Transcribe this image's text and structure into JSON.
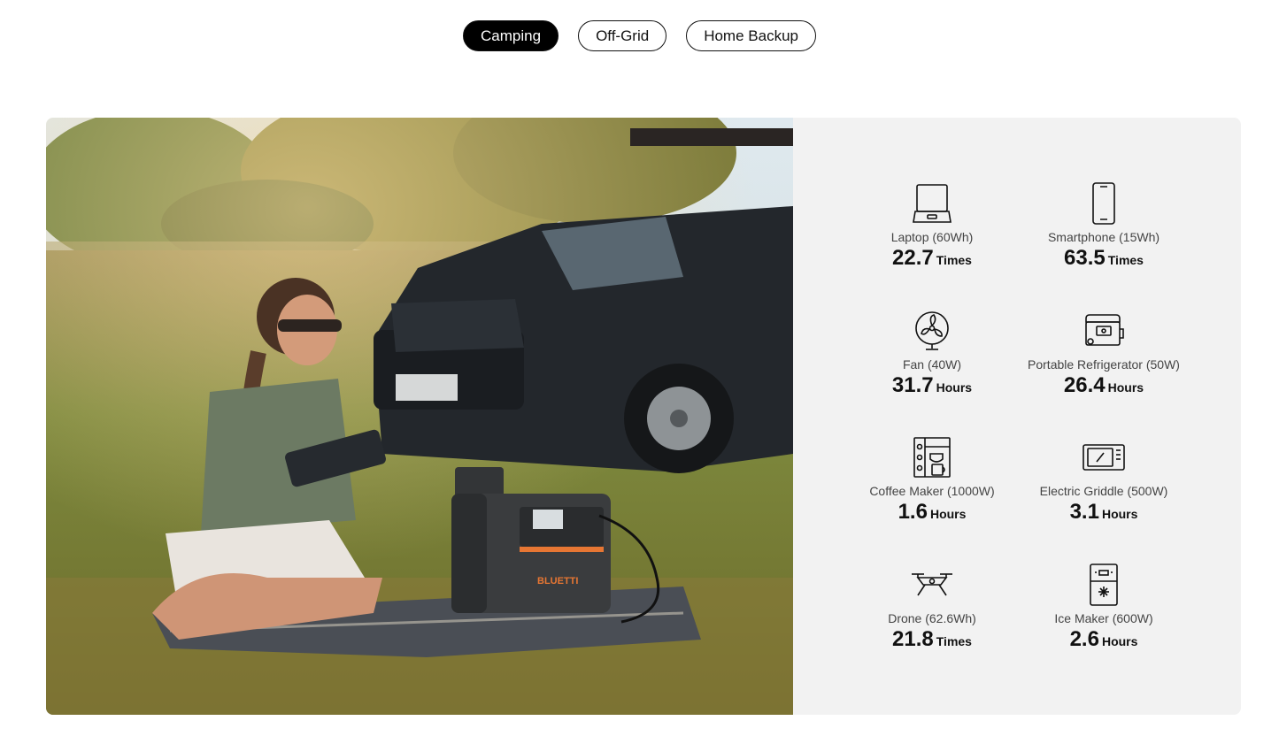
{
  "tabs": [
    {
      "label": "Camping",
      "active": true
    },
    {
      "label": "Off-Grid",
      "active": false
    },
    {
      "label": "Home Backup",
      "active": false
    }
  ],
  "photo": {
    "brand_text": "BLUETTI"
  },
  "devices": [
    {
      "icon": "laptop-icon",
      "label": "Laptop (60Wh)",
      "value": "22.7",
      "unit": "Times"
    },
    {
      "icon": "smartphone-icon",
      "label": "Smartphone (15Wh)",
      "value": "63.5",
      "unit": "Times"
    },
    {
      "icon": "fan-icon",
      "label": "Fan (40W)",
      "value": "31.7",
      "unit": "Hours"
    },
    {
      "icon": "portable-refrigerator-icon",
      "label": "Portable Refrigerator (50W)",
      "value": "26.4",
      "unit": "Hours"
    },
    {
      "icon": "coffee-maker-icon",
      "label": "Coffee Maker (1000W)",
      "value": "1.6",
      "unit": "Hours"
    },
    {
      "icon": "electric-griddle-icon",
      "label": "Electric Griddle (500W)",
      "value": "3.1",
      "unit": "Hours"
    },
    {
      "icon": "drone-icon",
      "label": "Drone (62.6Wh)",
      "value": "21.8",
      "unit": "Times"
    },
    {
      "icon": "ice-maker-icon",
      "label": "Ice Maker (600W)",
      "value": "2.6",
      "unit": "Hours"
    }
  ]
}
